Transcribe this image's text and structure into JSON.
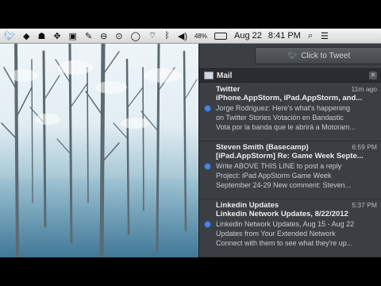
{
  "menubar": {
    "icons": [
      "twitter-icon",
      "dropbox-icon",
      "evernote-icon",
      "paw-icon",
      "briefcase-icon",
      "pen-icon",
      "clock-icon",
      "alarm-icon",
      "chat-bubble-icon",
      "wifi-icon",
      "bluetooth-icon",
      "volume-icon",
      "battery-icon"
    ],
    "battery_text": "48%",
    "date": "Aug 22",
    "time": "8:41 PM"
  },
  "notification_center": {
    "tweet_button_label": "Click to Tweet",
    "section_title": "Mail",
    "notifications": [
      {
        "sender": "Twitter",
        "time": "11m ago",
        "subject": "iPhone.AppStorm, iPad.AppStorm, and...",
        "lines": [
          "Jorge Rodriguez: Here's what's happening",
          "on Twitter Stories Votación en Bandastic",
          "Vota por la banda que le abrirá a Motoram..."
        ]
      },
      {
        "sender": "Steven Smith (Basecamp)",
        "time": "6:59 PM",
        "subject": "[iPad.AppStorm] Re: Game Week Septe...",
        "lines": [
          "Write ABOVE THIS LINE to post a reply",
          "Project: iPad AppStorm Game Week",
          "September 24-29 New comment: Steven..."
        ]
      },
      {
        "sender": "Linkedin Updates",
        "time": "5:37 PM",
        "subject": "Linkedin Network Updates, 8/22/2012",
        "lines": [
          "Linkedin Network Updates, Aug 15 - Aug 22",
          "Updates from Your Extended Network",
          "Connect with them to see what they're up..."
        ]
      }
    ]
  }
}
